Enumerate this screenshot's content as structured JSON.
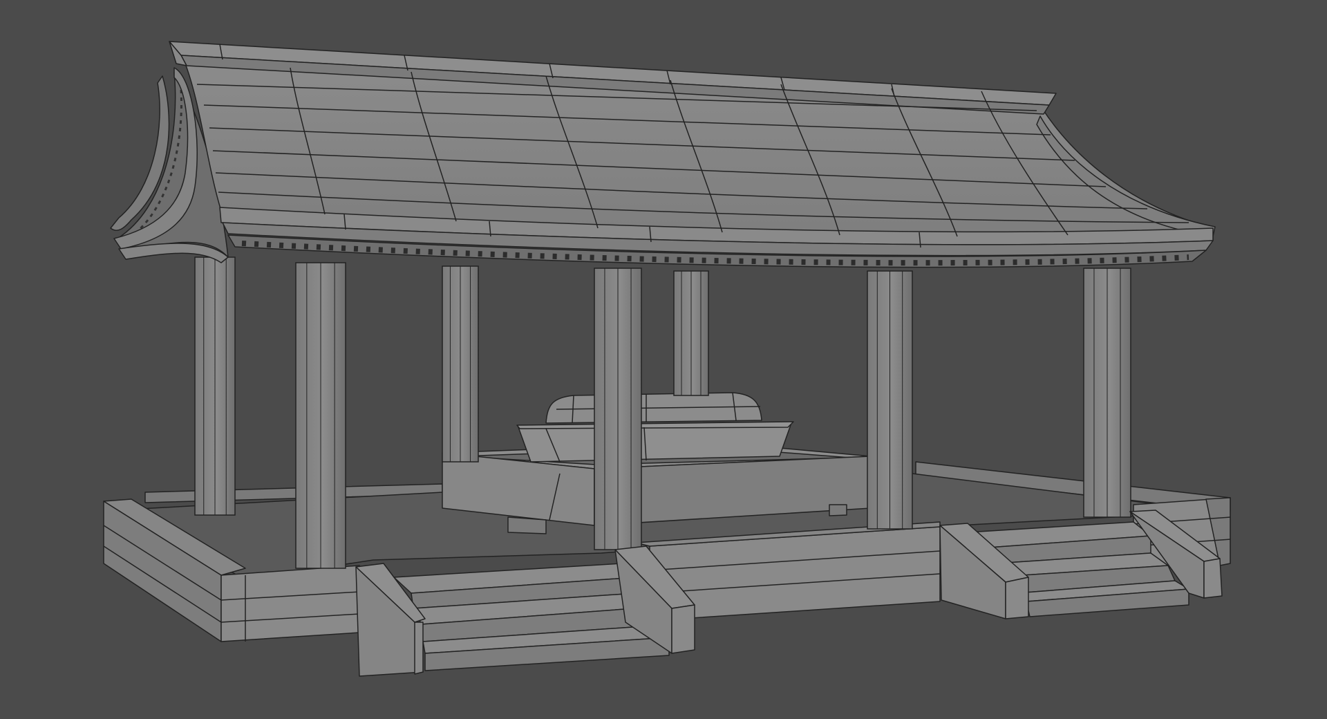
{
  "scene": {
    "subject": "",
    "render_style": "grey-clay-wireframe",
    "background_color": "#4b4b4b",
    "surface_color": "#858585",
    "edge_color": "#222222",
    "parts": {
      "roof": "roof",
      "columns": "column",
      "platform": "platform",
      "stairs": "stairs",
      "basin": "basin"
    }
  }
}
